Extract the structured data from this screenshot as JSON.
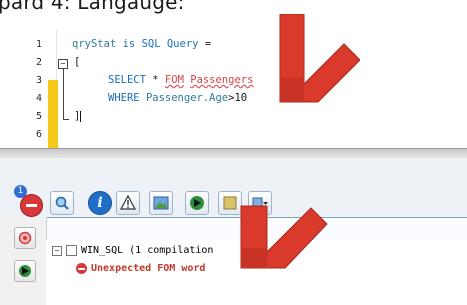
{
  "caption": "pard 4: Langauge:",
  "editor": {
    "line_numbers": [
      "1",
      "2",
      "3",
      "4",
      "5",
      "6"
    ],
    "line1": {
      "var": "qryStat",
      "is": "is",
      "type": "SQL Query",
      "eq": "="
    },
    "line2": "[",
    "line3": {
      "select": "SELECT",
      "star": "*",
      "fom": "FOM",
      "table": "Passengers"
    },
    "line4": {
      "where": "WHERE",
      "field": "Passenger.Age",
      "op": ">",
      "val": "10"
    },
    "line5": "]"
  },
  "pane": {
    "badge": "1",
    "tree_root": "WIN_SQL (1 compilation",
    "tree_error": "Unexpected FOM word"
  },
  "colors": {
    "arrow_red": "#d93a2b",
    "highlight_yellow": "#f4c718"
  }
}
